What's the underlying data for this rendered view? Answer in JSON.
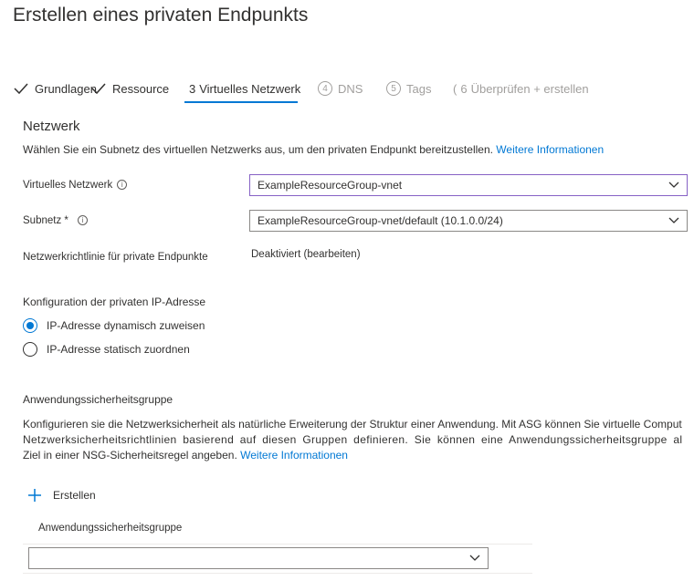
{
  "page": {
    "title": "Erstellen eines privaten Endpunkts"
  },
  "tabs": [
    {
      "num": "",
      "label": "Grundlagen",
      "state": "completed"
    },
    {
      "num": "",
      "label": "Ressource",
      "state": "completed"
    },
    {
      "num": "3",
      "label": "Virtuelles Netzwerk",
      "state": "active"
    },
    {
      "num": "4",
      "label": "DNS",
      "state": "disabled"
    },
    {
      "num": "5",
      "label": "Tags",
      "state": "disabled"
    },
    {
      "num": "6",
      "label": "Überprüfen + erstellen",
      "state": "disabled"
    }
  ],
  "network": {
    "heading": "Netzwerk",
    "description": "Wählen Sie ein Subnetz des virtuellen Netzwerks aus, um den privaten Endpunkt bereitzustellen.",
    "learn_more": "Weitere Informationen",
    "vnet_label": "Virtuelles Netzwerk",
    "vnet_value": "ExampleResourceGroup-vnet",
    "subnet_label": "Subnetz *",
    "subnet_value": "ExampleResourceGroup-vnet/default (10.1.0.0/24)",
    "policy_label": "Netzwerkrichtlinie für private Endpunkte",
    "policy_value": "Deaktiviert (bearbeiten)"
  },
  "ip_config": {
    "heading": "Konfiguration der privaten IP-Adresse",
    "option_dynamic": "IP-Adresse dynamisch zuweisen",
    "option_static": "IP-Adresse statisch zuordnen",
    "selected": "dynamic"
  },
  "asg": {
    "heading": "Anwendungssicherheitsgruppe",
    "line1": "Konfigurieren sie die Netzwerksicherheit als natürliche Erweiterung der Struktur einer Anwendung. Mit ASG können Sie virtuelle Comput",
    "line2": "Netzwerksicherheitsrichtlinien basierend auf diesen Gruppen definieren. Sie können eine Anwendungssicherheitsgruppe al",
    "line3_text": "Ziel in einer NSG-Sicherheitsregel angeben.",
    "learn_more": "Weitere Informationen",
    "create_label": "Erstellen",
    "column_header": "Anwendungssicherheitsgruppe",
    "select_value": ""
  },
  "colors": {
    "accent": "#0078d4",
    "focus_border": "#8661c5",
    "text": "#323130",
    "disabled": "#a19f9d"
  }
}
